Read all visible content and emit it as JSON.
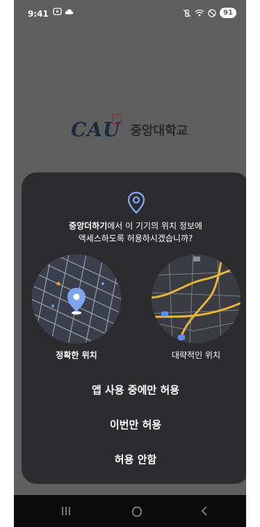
{
  "status_bar": {
    "time": "9:41",
    "battery": "91",
    "left_icons": [
      "screen-record-icon",
      "cloud-icon"
    ],
    "right_icons": [
      "mute-vibrate-icon",
      "wifi-icon",
      "do-not-disturb-icon"
    ]
  },
  "background": {
    "logo_text": "CAU",
    "university_name": "중앙대학교"
  },
  "dialog": {
    "app_name": "중앙더하기",
    "prompt_line1_suffix": "에서 이 기기의 위치 정보에",
    "prompt_line2": "액세스하도록 허용하시겠습니까?",
    "options": [
      {
        "label": "정확한 위치",
        "selected": true
      },
      {
        "label": "대략적인 위치",
        "selected": false
      }
    ],
    "actions": [
      "앱 사용 중에만 허용",
      "이번만 허용",
      "허용 안함"
    ]
  },
  "colors": {
    "accent": "#7fa4ef",
    "dialog_bg": "#2c2c2e",
    "scrim": "#5f5f5f"
  },
  "nav_bar": {
    "buttons": [
      "recent-apps-icon",
      "home-icon",
      "back-icon"
    ]
  }
}
